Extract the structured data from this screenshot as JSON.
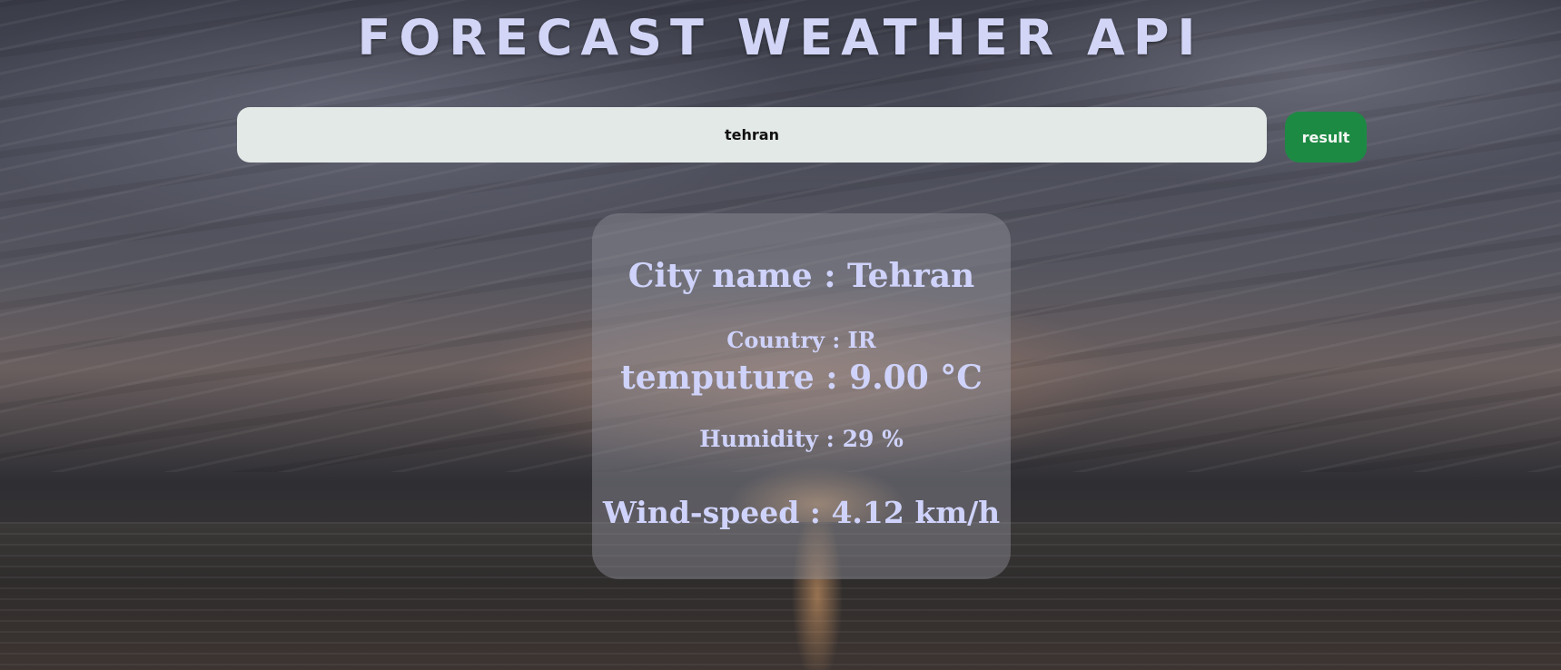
{
  "page": {
    "title": "FORECAST WEATHER API"
  },
  "search": {
    "value": "tehran",
    "button_label": "result"
  },
  "weather": {
    "city": "City name : Tehran",
    "country": "Country : IR",
    "temperature": "temputure : 9.00 °C",
    "humidity": "Humidity : 29 %",
    "wind_speed": "Wind-speed : 4.12 km/h"
  },
  "colors": {
    "title": "#d2d5f6",
    "button": "#1d8a44",
    "input_bg": "#e3e9e6",
    "card_text": "#cfd3fb"
  }
}
